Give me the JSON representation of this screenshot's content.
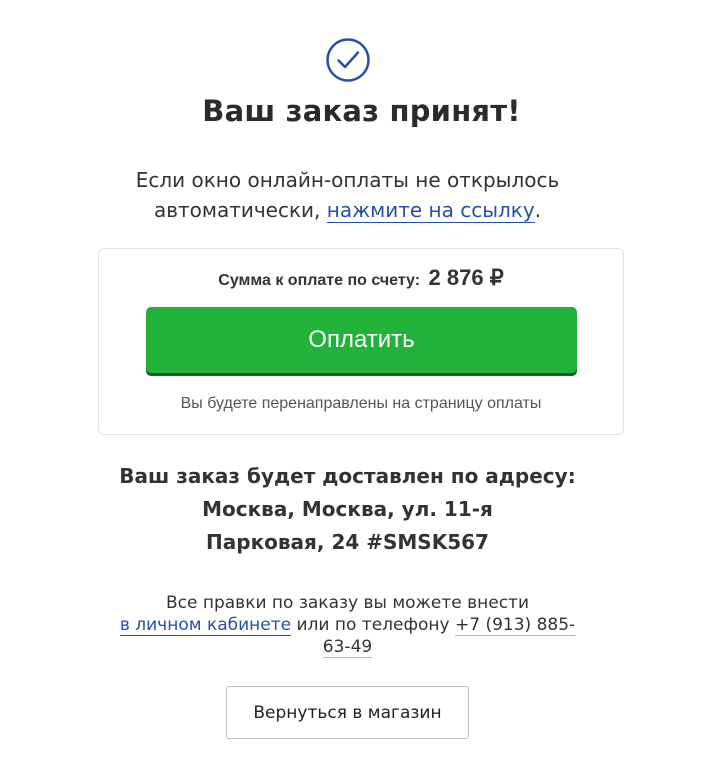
{
  "icons": {
    "success": "check-circle-icon"
  },
  "colors": {
    "accent_blue": "#2b4fa8",
    "pay_green": "#22b23a"
  },
  "title": "Ваш заказ принят!",
  "subtitle": {
    "line1": "Если окно онлайн-оплаты не открылось",
    "line2_prefix": "автоматически, ",
    "link": "нажмите на ссылку",
    "line2_suffix": "."
  },
  "payment": {
    "sum_label": "Сумма к оплате по счету:",
    "sum_value": "2 876 ₽",
    "pay_button": "Оплатить",
    "redirect_note": "Вы будете перенаправлены на страницу оплаты"
  },
  "delivery": {
    "line1": "Ваш заказ будет доставлен по адресу:",
    "line2": "Москва, Москва, ул. 11-я",
    "line3": "Парковая, 24 #SMSK567"
  },
  "notes": {
    "line1": "Все правки по заказу вы можете внести",
    "cabinet_link": "в личном кабинете",
    "middle": " или по телефону ",
    "phone_part1": "+7 (913) 885-",
    "phone_part2": "63-49"
  },
  "back_button": "Вернуться в магазин"
}
